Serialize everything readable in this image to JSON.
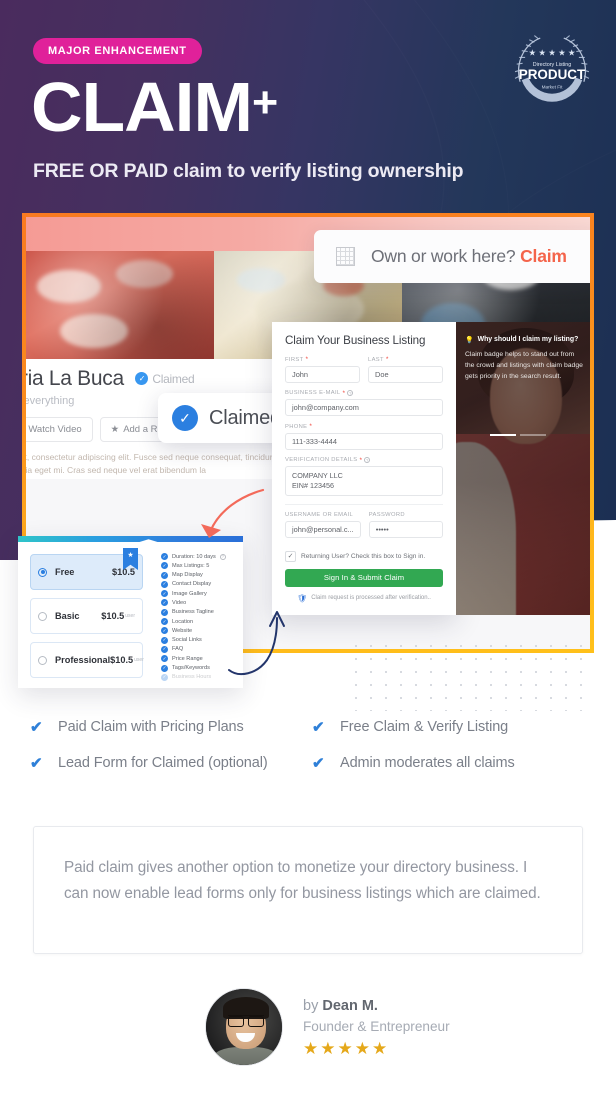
{
  "hero": {
    "badge": "MAJOR ENHANCEMENT",
    "title": "CLAIM",
    "title_plus": "+",
    "subtitle": "FREE OR PAID claim to verify listing ownership",
    "bg_left_color": "#472B5C",
    "bg_right_color": "#1C2F54",
    "badge_color": "#E0219A",
    "award": {
      "line1": "Directory Listing",
      "line2": "PRODUCT",
      "line3": "Market Fit",
      "stars": "★ ★ ★ ★ ★"
    }
  },
  "screenshot": {
    "border_color": "#FBA01D",
    "own_bar": {
      "icon": "grid-icon",
      "text_prefix": "Own or work here? ",
      "link": "Claim",
      "link_color": "#F4644B"
    },
    "listing": {
      "title": "teria La Buca",
      "verified_label": "Claimed",
      "tagline": "y is everything",
      "buttons": [
        "Watch Video",
        "Add a R"
      ],
      "body_text": "amet, consectetur adipiscing elit. Fusce sed neque consequat, tincidunt tortor at. nare et interdum sit amet, lacinia eget mi. Cras sed neque vel erat bibendum la"
    },
    "claimed_tooltip": {
      "label": "Claimed",
      "icon": "check-circle-icon",
      "color": "#2B7FE0"
    },
    "form": {
      "title": "Claim Your Business Listing",
      "fields": [
        {
          "label": "FIRST",
          "required": true,
          "value": "John"
        },
        {
          "label": "LAST",
          "required": true,
          "value": "Doe"
        },
        {
          "label": "BUSINESS E-MAIL",
          "required": true,
          "help": true,
          "value": "john@company.com"
        },
        {
          "label": "PHONE",
          "required": true,
          "value": "111-333-4444"
        },
        {
          "label": "VERIFICATION DETAILS",
          "required": true,
          "help": true,
          "value": "COMPANY LLC\nEIN# 123456"
        },
        {
          "label": "USERNAME OR EMAIL",
          "required": false,
          "value": "john@personal.c..."
        },
        {
          "label": "PASSWORD",
          "required": false,
          "value": "•••••"
        }
      ],
      "checkbox_label": "Returning User? Check this box to Sign in.",
      "checkbox_checked": true,
      "submit_label": "Sign In & Submit Claim",
      "submit_color": "#32A852",
      "note": "Claim request is processed after verification.."
    },
    "photo_tip": {
      "title": "Why should I claim my listing?",
      "body": "Claim badge helps to stand out from the crowd and listings with claim badge gets priority in the search result."
    },
    "pricing": {
      "plans": [
        {
          "name": "Free",
          "price": "$10.5",
          "per": "",
          "selected": true,
          "ribbon": true
        },
        {
          "name": "Basic",
          "price": "$10.5",
          "per": "user",
          "selected": false,
          "ribbon": false
        },
        {
          "name": "Professional",
          "price": "$10.5",
          "per": "user",
          "selected": false,
          "ribbon": false
        }
      ],
      "features": [
        {
          "label": "Duration: 10 days",
          "help": true
        },
        {
          "label": "Max Listings: 5",
          "help": false
        },
        {
          "label": "Map Display",
          "help": false
        },
        {
          "label": "Contact Display",
          "help": false
        },
        {
          "label": "Image Gallery",
          "help": false
        },
        {
          "label": "Video",
          "help": false
        },
        {
          "label": "Business Tagline",
          "help": false
        },
        {
          "label": "Location",
          "help": false
        },
        {
          "label": "Website",
          "help": false
        },
        {
          "label": "Social Links",
          "help": false
        },
        {
          "label": "FAQ",
          "help": false
        },
        {
          "label": "Price Range",
          "help": false
        },
        {
          "label": "Tags/Keywords",
          "help": false
        },
        {
          "label": "Business Hours",
          "help": false
        }
      ]
    }
  },
  "features_list": [
    "Paid Claim with Pricing Plans",
    "Free Claim & Verify Listing",
    "Lead Form for Claimed (optional)",
    "Admin moderates all claims"
  ],
  "testimonial": {
    "quote": "Paid claim gives another option to monetize your directory business. I can now enable lead forms only for business listings which are claimed.",
    "author_by": "by ",
    "author_name": "Dean M.",
    "author_role": "Founder & Entrepreneur",
    "stars": "★★★★★",
    "star_color": "#E5A81A"
  }
}
